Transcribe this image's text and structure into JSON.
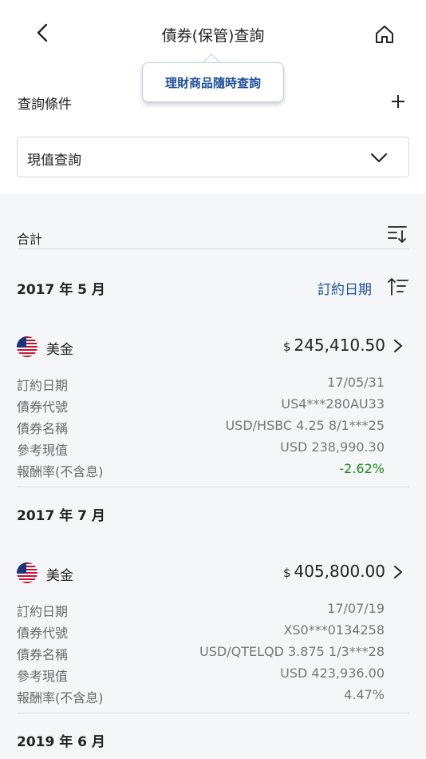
{
  "header": {
    "title": "債券(保管)查詢"
  },
  "tooltip": {
    "text": "理財商品隨時查詢"
  },
  "query": {
    "label": "查詢條件",
    "selected": "現值查詢"
  },
  "summary": {
    "label": "合計"
  },
  "sort": {
    "label": "訂約日期"
  },
  "groups": [
    {
      "month": "2017 年 5 月",
      "bond": {
        "currency": "美金",
        "currency_symbol": "$",
        "amount": "245,410.50",
        "fields": [
          {
            "label": "訂約日期",
            "value": "17/05/31"
          },
          {
            "label": "債券代號",
            "value": "US4***280AU33"
          },
          {
            "label": "債券名稱",
            "value": "USD/HSBC 4.25 8/1***25"
          },
          {
            "label": "參考現值",
            "value": "USD 238,990.30"
          },
          {
            "label": "報酬率(不含息)",
            "value": "-2.62%"
          }
        ]
      }
    },
    {
      "month": "2017 年 7 月",
      "bond": {
        "currency": "美金",
        "currency_symbol": "$",
        "amount": "405,800.00",
        "fields": [
          {
            "label": "訂約日期",
            "value": "17/07/19"
          },
          {
            "label": "債券代號",
            "value": "XS0***0134258"
          },
          {
            "label": "債券名稱",
            "value": "USD/QTELQD 3.875 1/3***28"
          },
          {
            "label": "參考現值",
            "value": "USD 423,936.00"
          },
          {
            "label": "報酬率(不含息)",
            "value": "4.47%"
          }
        ]
      }
    },
    {
      "month": "2019 年 6 月"
    }
  ],
  "colors": {
    "accent": "#1f4f9c",
    "positive_return": "#1a8a1a",
    "band": "#f4f6f8"
  },
  "icons": [
    "back-arrow-icon",
    "home-icon",
    "plus-icon",
    "chevron-down-icon",
    "filter-sort-icon",
    "sort-ascending-icon",
    "us-flag-icon",
    "chevron-right-icon"
  ]
}
